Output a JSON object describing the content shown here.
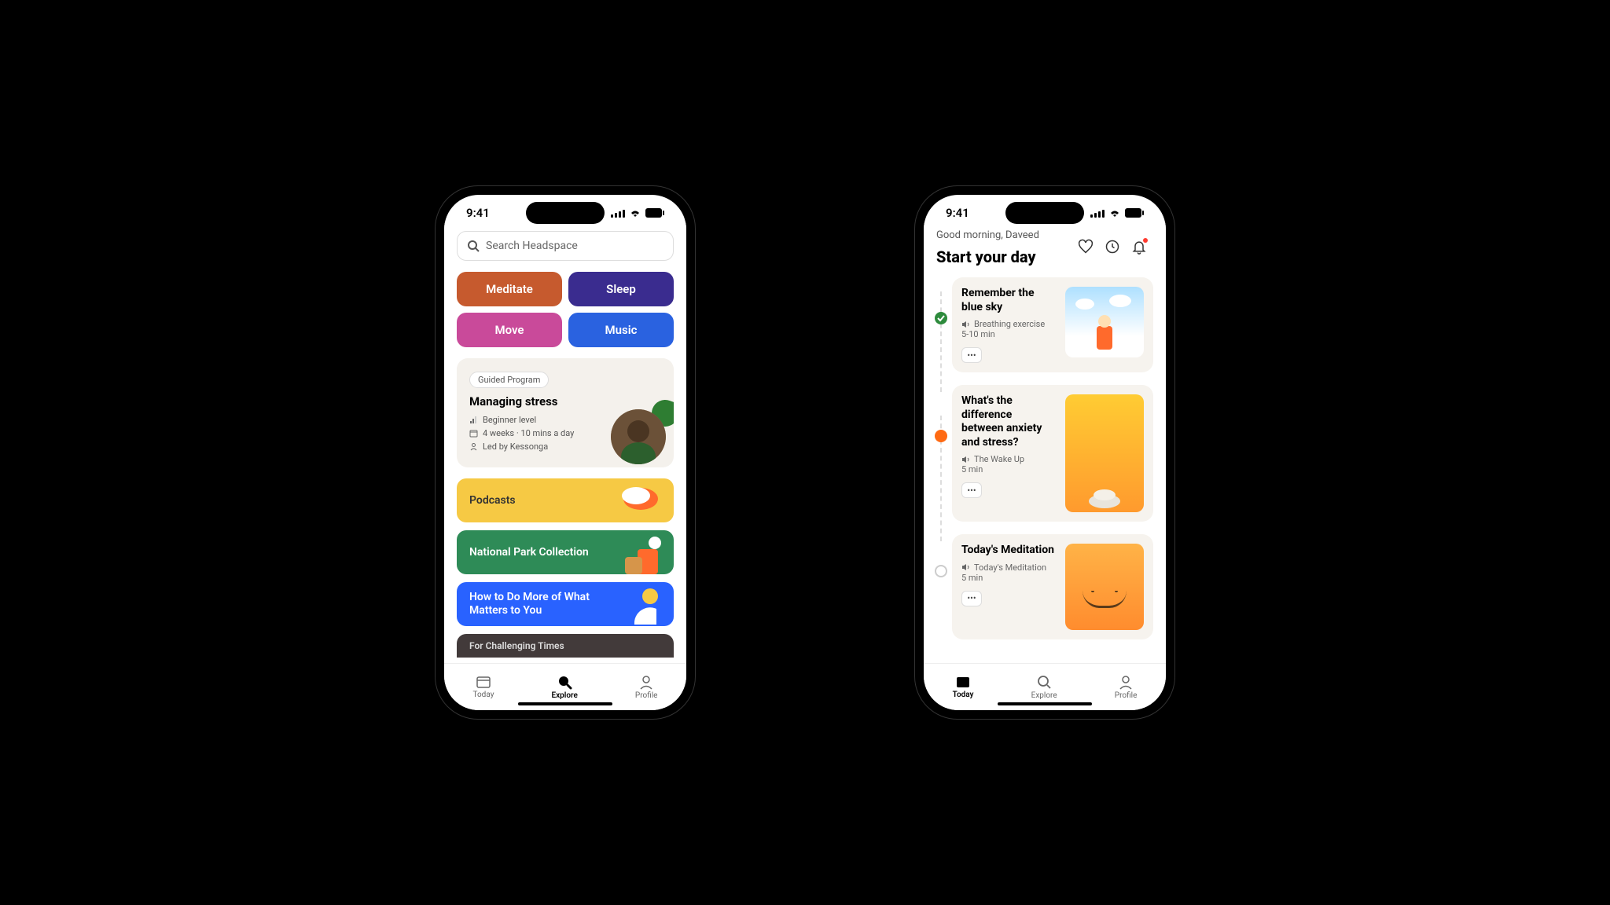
{
  "status": {
    "time": "9:41"
  },
  "phoneA": {
    "search_placeholder": "Search Headspace",
    "categories": [
      {
        "label": "Meditate",
        "color": "#c65a2e"
      },
      {
        "label": "Sleep",
        "color": "#3a2c8f"
      },
      {
        "label": "Move",
        "color": "#c94a9a"
      },
      {
        "label": "Music",
        "color": "#2a62e0"
      }
    ],
    "program": {
      "pill": "Guided Program",
      "title": "Managing stress",
      "level": "Beginner level",
      "duration": "4 weeks · 10 mins a day",
      "led_by": "Led by Kessonga"
    },
    "rows": {
      "podcasts": "Podcasts",
      "parks": "National Park Collection",
      "howto": "How to Do More of What Matters to You",
      "cut": "For Challenging Times"
    },
    "tabs": {
      "today": "Today",
      "explore": "Explore",
      "profile": "Profile"
    }
  },
  "phoneB": {
    "greeting": "Good morning, Daveed",
    "start_title": "Start your day",
    "cards": [
      {
        "title": "Remember the blue sky",
        "type": "Breathing exercise",
        "duration": "5-10 min"
      },
      {
        "title": "What's the difference between anxiety and stress?",
        "type": "The Wake Up",
        "duration": "5 min"
      },
      {
        "title": "Today's Meditation",
        "type": "Today's Meditation",
        "duration": "5 min"
      }
    ],
    "tabs": {
      "today": "Today",
      "explore": "Explore",
      "profile": "Profile"
    }
  }
}
